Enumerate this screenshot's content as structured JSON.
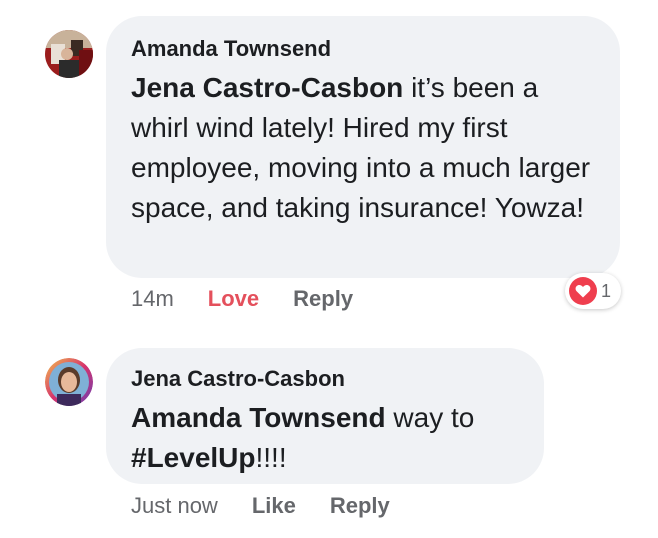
{
  "comments": [
    {
      "author": "Amanda Townsend",
      "mention": "Jena Castro-Casbon",
      "text": " it’s been a whirl wind lately! Hired my first employee, moving into a much larger space, and taking insurance! Yowza!",
      "time": "14m",
      "love_label": "Love",
      "reply_label": "Reply",
      "reaction": {
        "icon": "heart-icon",
        "count": "1",
        "color": "#ef3e4e"
      }
    },
    {
      "author": "Jena Castro-Casbon",
      "mention": "Amanda Townsend",
      "text_before_tag": " way to ",
      "hashtag": "#LevelUp",
      "text_after_tag": "!!!!",
      "time": "Just now",
      "like_label": "Like",
      "reply_label": "Reply"
    }
  ],
  "colors": {
    "bubble": "#f0f2f5",
    "love": "#e4505c",
    "meta": "#65676b"
  }
}
